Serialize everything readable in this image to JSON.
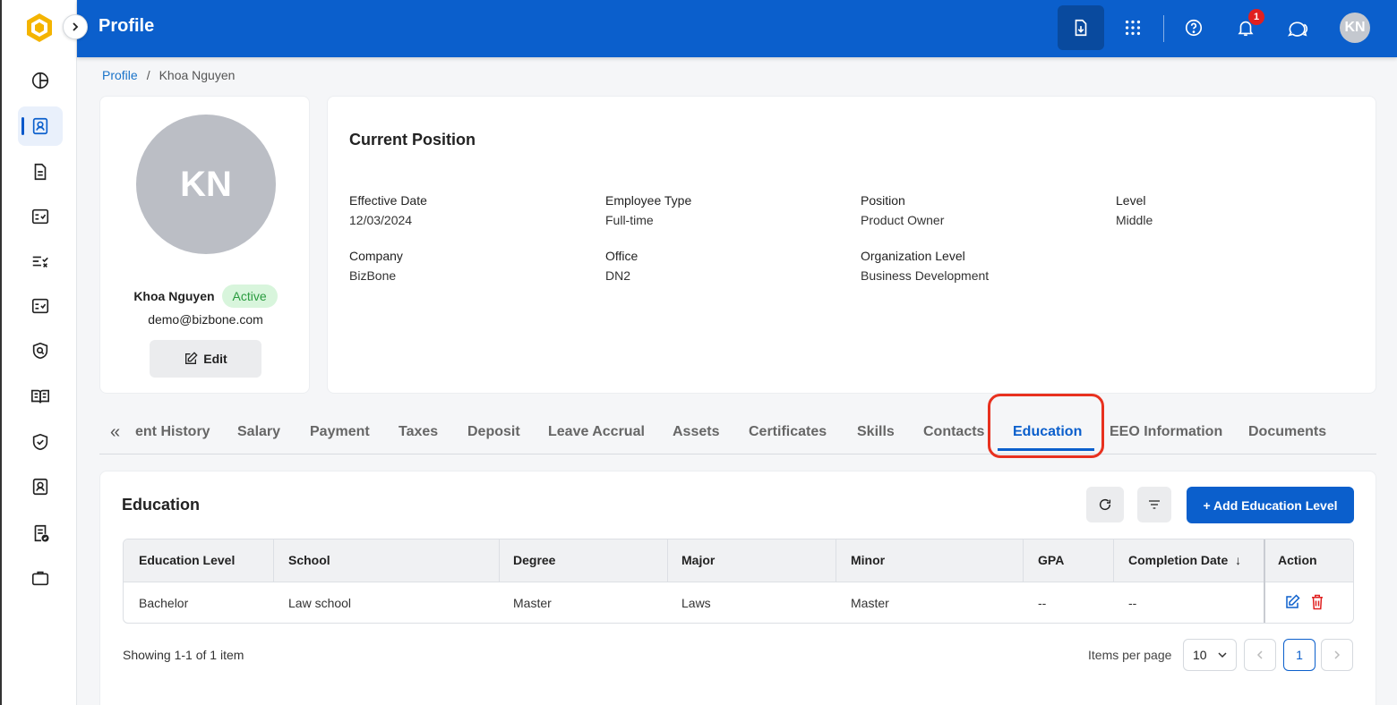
{
  "header": {
    "title": "Profile",
    "notification_count": "1",
    "avatar_initials": "KN"
  },
  "breadcrumb": {
    "root": "Profile",
    "separator": "/",
    "current": "Khoa Nguyen"
  },
  "profile": {
    "initials": "KN",
    "name": "Khoa Nguyen",
    "status": "Active",
    "email": "demo@bizbone.com",
    "edit_label": "Edit"
  },
  "position": {
    "title": "Current Position",
    "fields": [
      {
        "label": "Effective Date",
        "value": "12/03/2024"
      },
      {
        "label": "Employee Type",
        "value": "Full-time"
      },
      {
        "label": "Position",
        "value": "Product Owner"
      },
      {
        "label": "Level",
        "value": "Middle"
      },
      {
        "label": "Company",
        "value": "BizBone"
      },
      {
        "label": "Office",
        "value": "DN2"
      },
      {
        "label": "Organization Level",
        "value": "Business Development"
      }
    ]
  },
  "tabs": {
    "scroll_icon": "«",
    "items": [
      "ent History",
      "Salary",
      "Payment",
      "Taxes",
      "Deposit",
      "Leave Accrual",
      "Assets",
      "Certificates",
      "Skills",
      "Contacts",
      "Education",
      "EEO Information",
      "Documents"
    ],
    "active": "Education"
  },
  "education": {
    "title": "Education",
    "add_label": "+ Add Education Level",
    "columns": [
      "Education Level",
      "School",
      "Degree",
      "Major",
      "Minor",
      "GPA",
      "Completion Date",
      "Action"
    ],
    "sort_indicator": "↓",
    "rows": [
      [
        "Bachelor",
        "Law school",
        "Master",
        "Laws",
        "Master",
        "--",
        "--"
      ]
    ],
    "showing": "Showing 1-1 of 1 item",
    "items_per_page_label": "Items per page",
    "items_per_page": "10",
    "current_page": "1"
  },
  "colors": {
    "primary": "#0b5fcc",
    "active_badge_bg": "#d8f5dc",
    "active_badge_text": "#2a9b3f",
    "highlight": "#e8311f",
    "danger": "#e02020"
  }
}
